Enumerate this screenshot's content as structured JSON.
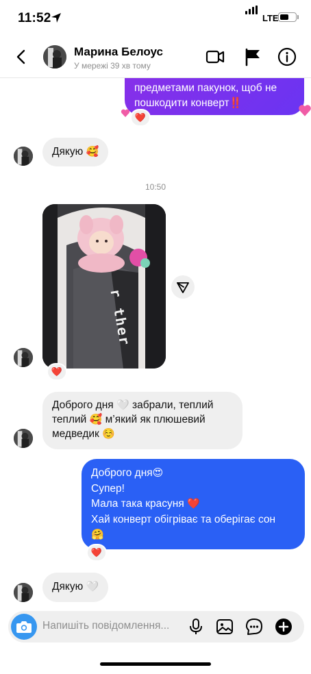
{
  "status_bar": {
    "time": "11:52",
    "network": "LTE",
    "battery_level": 0.55
  },
  "header": {
    "name": "Марина Белоус",
    "status": "У мережі 39 хв тому"
  },
  "messages": {
    "out_prev": {
      "text": "предметами пакунок, щоб не пошкодити конверт",
      "emoji": "‼️",
      "reaction": "❤️"
    },
    "in_thanks_1": {
      "text": "Дякую",
      "emoji": "🥰"
    },
    "timestamp": "10:50",
    "photo_reaction": "❤️",
    "photo_text": "r ther",
    "in_good_day": {
      "line1_a": "Доброго дня",
      "line1_emoji": "🤍",
      "line1_b": " забрали, теплий",
      "line2_a": "теплий",
      "line2_emoji": "🥰",
      "line2_b": " м’який як плюшевий",
      "line3_a": "медведик",
      "line3_emoji": "☺️"
    },
    "out_reply": {
      "line1": "Доброго дня",
      "line1_emoji": "😍",
      "line2": "Супер!",
      "line3": "Мала така красуня",
      "line3_emoji": "❤️",
      "line4": "Хай конверт обігріває та оберігає сон",
      "line5_emoji": "🤗",
      "reaction": "❤️"
    },
    "in_thanks_2": {
      "text": "Дякую",
      "emoji": "🤍"
    }
  },
  "composer": {
    "placeholder": "Напишіть повідомлення..."
  },
  "colors": {
    "out_bubble_blue": "#2a60f5",
    "out_bubble_purple": "#7b2ff0",
    "camera_blue": "#3797f0"
  },
  "icons": [
    "location-arrow-icon",
    "back-chevron-icon",
    "video-call-icon",
    "flag-icon",
    "info-icon",
    "send-share-icon",
    "camera-icon",
    "microphone-icon",
    "gallery-icon",
    "sticker-chat-icon",
    "plus-circle-icon"
  ]
}
